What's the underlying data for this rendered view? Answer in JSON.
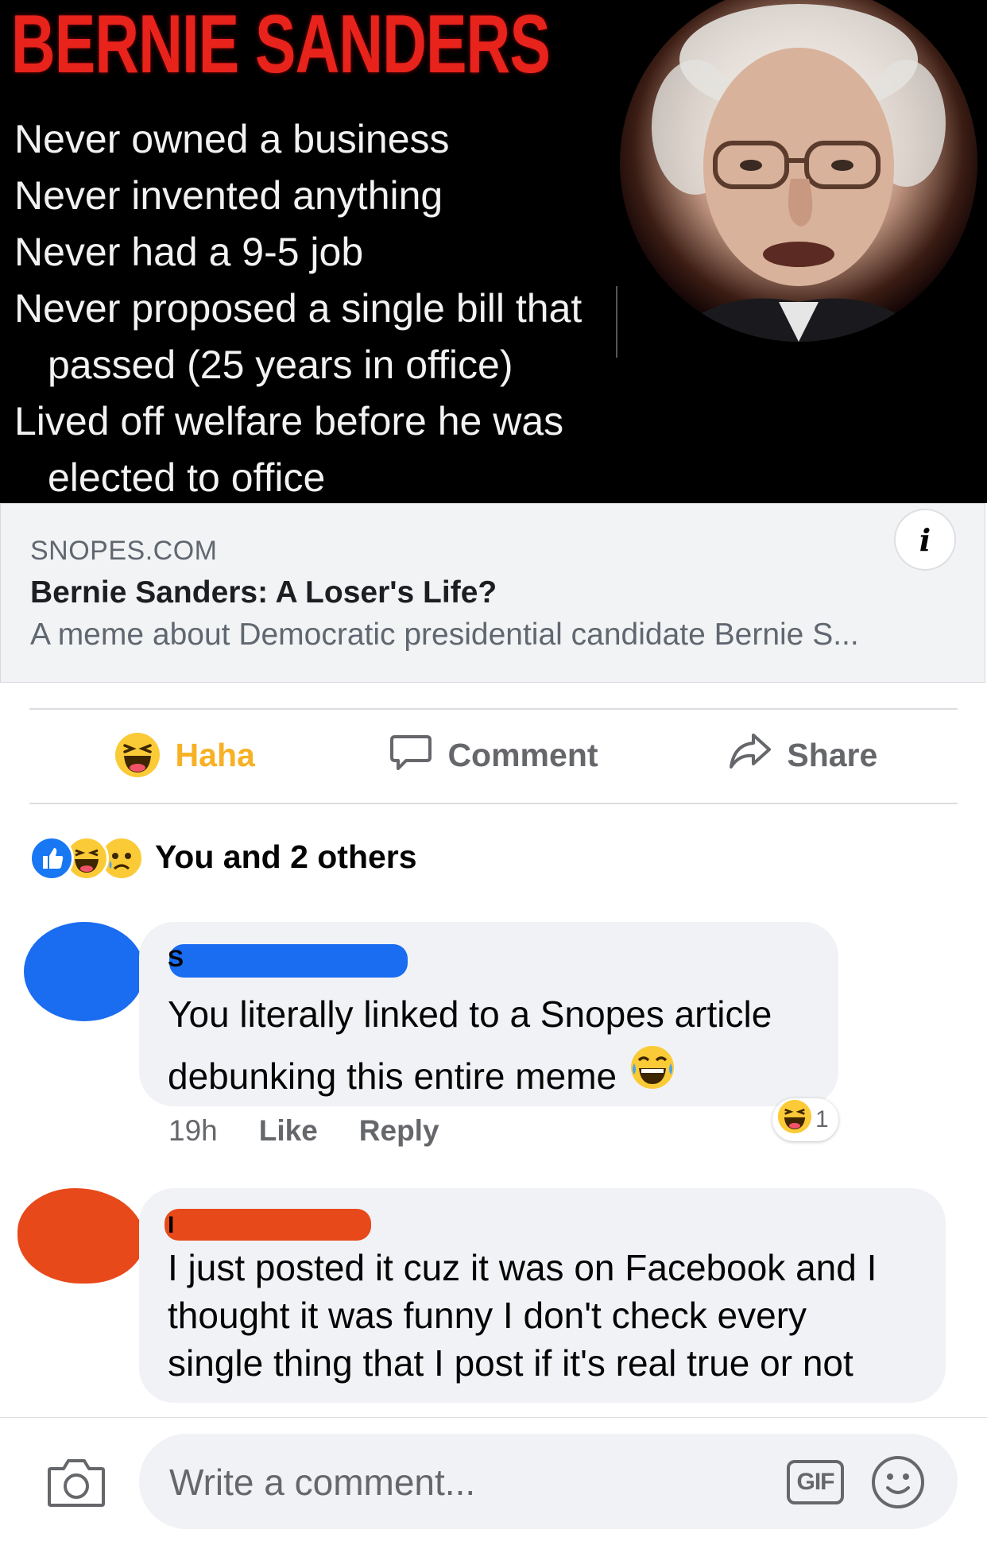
{
  "meme": {
    "title": "BERNIE SANDERS",
    "lines": [
      "Never owned a business",
      "Never invented anything",
      "Never had a 9-5 job",
      "Never proposed a single bill that",
      "passed  (25 years in office)",
      "Lived off welfare before he was",
      "elected to office"
    ]
  },
  "link_preview": {
    "domain": "SNOPES.COM",
    "title": "Bernie Sanders: A Loser's Life?",
    "description": "A meme about Democratic presidential candidate Bernie S...",
    "info_icon": "i"
  },
  "actions": {
    "haha": "Haha",
    "comment": "Comment",
    "share": "Share"
  },
  "reactions": {
    "summary": "You and 2 others",
    "icons": [
      "like-icon",
      "haha-icon",
      "sad-icon"
    ]
  },
  "comments": [
    {
      "author_initial": "S",
      "text_lines": [
        "You literally linked to a Snopes article",
        "debunking this entire meme"
      ],
      "time": "19h",
      "like": "Like",
      "reply": "Reply",
      "reaction_count": "1",
      "avatar_color": "#1a6cf0"
    },
    {
      "author_initial": "I",
      "text_lines": [
        "I just posted it cuz it was on Facebook and I",
        "thought it was funny I don't check every",
        "single thing that I post if it's real true or not"
      ],
      "avatar_color": "#e8491a"
    }
  ],
  "composer": {
    "placeholder": "Write a comment...",
    "gif": "GIF"
  },
  "colors": {
    "haha": "#f7b125",
    "like_blue": "#1877f2",
    "meme_title": "#e8231c",
    "redact_blue": "#1a6cf0",
    "redact_orange": "#e8491a"
  }
}
